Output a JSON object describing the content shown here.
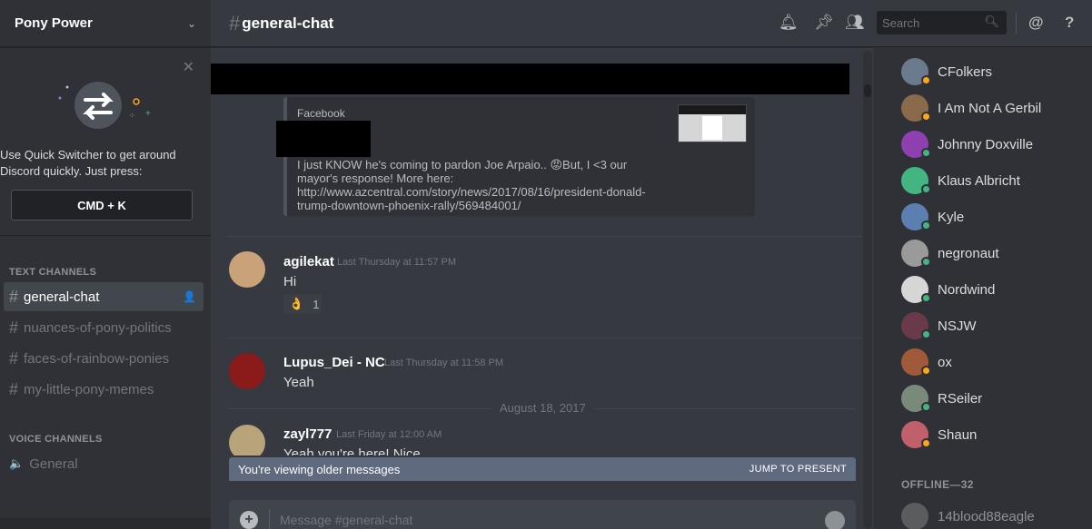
{
  "server": {
    "name": "Pony Power"
  },
  "quick_switcher": {
    "text": "Use Quick Switcher to get around Discord quickly. Just press:",
    "shortcut": "CMD + K"
  },
  "text_channels": {
    "title": "TEXT CHANNELS",
    "items": [
      {
        "name": "general-chat",
        "active": true
      },
      {
        "name": "nuances-of-pony-politics"
      },
      {
        "name": "faces-of-rainbow-ponies"
      },
      {
        "name": "my-little-pony-memes"
      }
    ]
  },
  "voice_channels": {
    "title": "VOICE CHANNELS",
    "items": [
      {
        "name": "General"
      }
    ]
  },
  "header": {
    "hash": "#",
    "channel": "general-chat",
    "search_placeholder": "Search"
  },
  "embed": {
    "provider": "Facebook",
    "description": "I just KNOW he's coming to pardon Joe Arpaio.. 😡But, I <3 our mayor's response! More here: http://www.azcentral.com/story/news/2017/08/16/president-donald-trump-downtown-phoenix-rally/569484001/"
  },
  "messages": [
    {
      "author": "agilekat",
      "timestamp": "Last Thursday at 11:57 PM",
      "text": "Hi",
      "reaction": {
        "emoji": "👌",
        "count": "1"
      }
    },
    {
      "author": "Lupus_Dei - NC",
      "timestamp": "Last Thursday at 11:58 PM",
      "text": "Yeah"
    },
    {
      "author": "zayl777",
      "timestamp": "Last Friday at 12:00 AM",
      "text": "Yeah you're here! Nice"
    }
  ],
  "date_divider": "August 18, 2017",
  "older_banner": {
    "text": "You're viewing older messages",
    "jump": "JUMP TO PRESENT"
  },
  "composer": {
    "placeholder": "Message #general-chat"
  },
  "members": {
    "online": [
      {
        "name": "CFolkers",
        "status": "#faa61a",
        "avatar": "#6b7a8c"
      },
      {
        "name": "I Am Not A Gerbil",
        "status": "#faa61a",
        "avatar": "#8a6a4a"
      },
      {
        "name": "Johnny Doxville",
        "status": "#43b581",
        "avatar": "#8e3fb0"
      },
      {
        "name": "Klaus Albricht",
        "status": "#43b581",
        "avatar": "#43b581"
      },
      {
        "name": "Kyle",
        "status": "#43b581",
        "avatar": "#5a7fb0"
      },
      {
        "name": "negronaut",
        "status": "#43b581",
        "avatar": "#9a9a9a"
      },
      {
        "name": "Nordwind",
        "status": "#43b581",
        "avatar": "#d6d6d6"
      },
      {
        "name": "NSJW",
        "status": "#43b581",
        "avatar": "#6a3a4a"
      },
      {
        "name": "ox",
        "status": "#faa61a",
        "avatar": "#a05a3a"
      },
      {
        "name": "RSeiler",
        "status": "#43b581",
        "avatar": "#7a8a7a"
      },
      {
        "name": "Shaun",
        "status": "#faa61a",
        "avatar": "#c0606a"
      }
    ],
    "offline_title": "OFFLINE—32",
    "offline": [
      {
        "name": "14blood88eagle",
        "avatar": "#7a7a7a"
      }
    ]
  }
}
